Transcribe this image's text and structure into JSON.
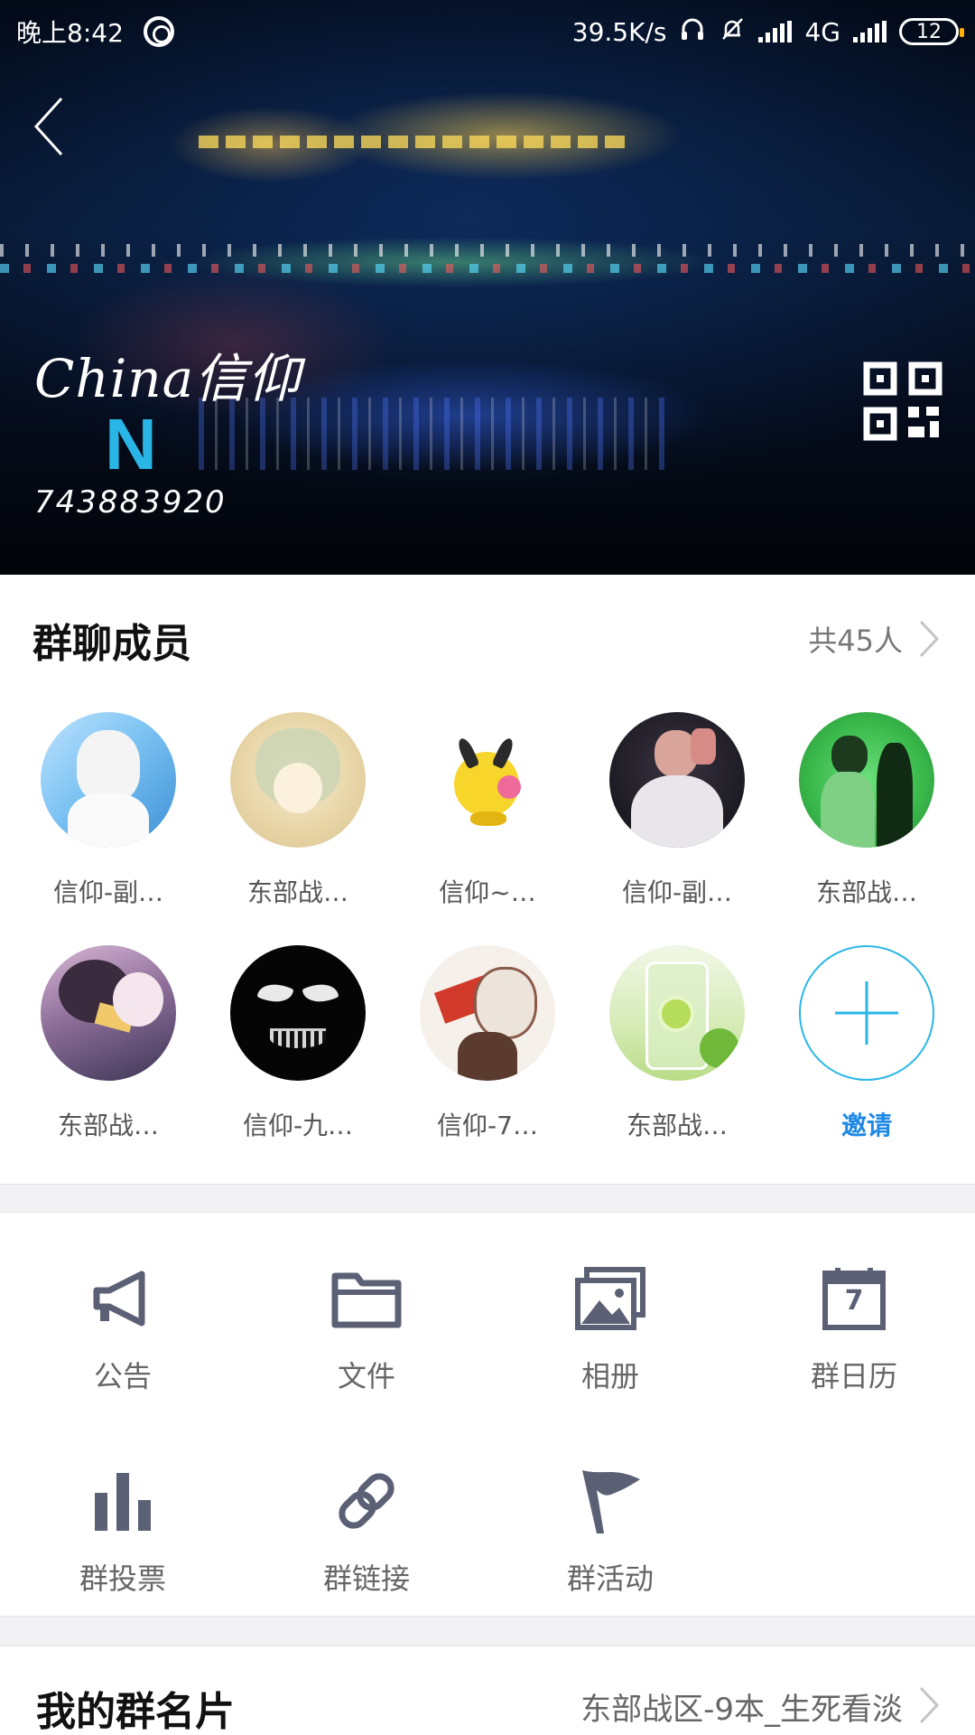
{
  "status_bar": {
    "time": "晚上8:42",
    "speed": "39.5K/s",
    "network": "4G",
    "battery": "12"
  },
  "group": {
    "name": "China信仰",
    "logo_letter": "N",
    "id": "743883920"
  },
  "members": {
    "title": "群聊成员",
    "count": "共45人",
    "list": [
      {
        "name": "信仰-副…"
      },
      {
        "name": "东部战…"
      },
      {
        "name": "信仰~…"
      },
      {
        "name": "信仰-副…"
      },
      {
        "name": "东部战…"
      },
      {
        "name": "东部战…"
      },
      {
        "name": "信仰-九…"
      },
      {
        "name": "信仰-7…"
      },
      {
        "name": "东部战…"
      }
    ],
    "invite_label": "邀请"
  },
  "functions": [
    {
      "label": "公告",
      "icon": "megaphone-icon"
    },
    {
      "label": "文件",
      "icon": "folder-icon"
    },
    {
      "label": "相册",
      "icon": "photo-album-icon"
    },
    {
      "label": "群日历",
      "icon": "calendar-icon",
      "calendar_day": "7"
    },
    {
      "label": "群投票",
      "icon": "bar-chart-icon"
    },
    {
      "label": "群链接",
      "icon": "link-icon"
    },
    {
      "label": "群活动",
      "icon": "flag-icon"
    }
  ],
  "my_card": {
    "title": "我的群名片",
    "value": "东部战区-9本_生死看淡"
  },
  "colors": {
    "accent": "#1e88e5",
    "icon": "#5b6075",
    "logo": "#29b6e6"
  }
}
